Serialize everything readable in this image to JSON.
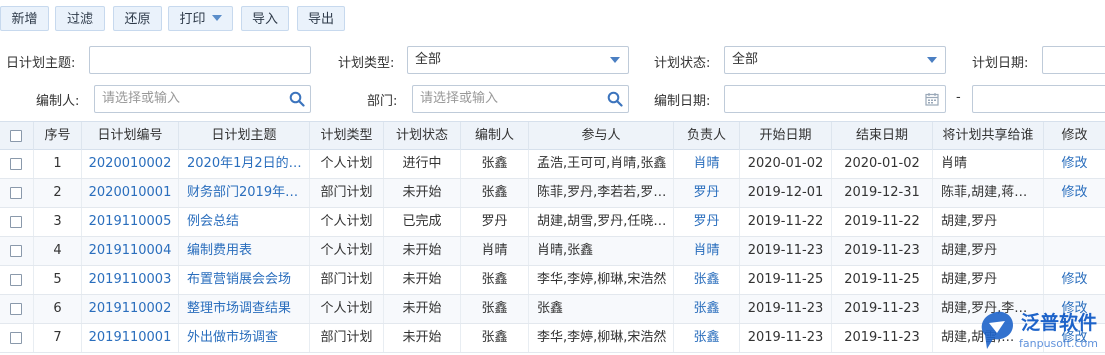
{
  "toolbar": {
    "new": "新增",
    "filter": "过滤",
    "reset": "还原",
    "print": "打印",
    "import": "导入",
    "export": "导出"
  },
  "filters": {
    "topic_label": "日计划主题:",
    "topic_value": "",
    "type_label": "计划类型:",
    "type_value": "全部",
    "status_label": "计划状态:",
    "status_value": "全部",
    "date_label": "计划日期:",
    "editor_label": "编制人:",
    "editor_placeholder": "请选择或输入",
    "dept_label": "部门:",
    "dept_placeholder": "请选择或输入",
    "edit_date_label": "编制日期:",
    "range_separator": "-"
  },
  "table": {
    "columns": [
      "序号",
      "日计划编号",
      "日计划主题",
      "计划类型",
      "计划状态",
      "编制人",
      "参与人",
      "负责人",
      "开始日期",
      "结束日期",
      "将计划共享给谁",
      "修改"
    ],
    "rows": [
      {
        "no": "1",
        "code": "2020010002",
        "topic": "2020年1月2日的…",
        "type": "个人计划",
        "status": "进行中",
        "editor": "张鑫",
        "participants": "孟浩,王可可,肖晴,张鑫",
        "owner": "肖晴",
        "start": "2020-01-02",
        "end": "2020-01-02",
        "share": "肖晴",
        "edit": "修改"
      },
      {
        "no": "2",
        "code": "2020010001",
        "topic": "财务部门2019年…",
        "type": "部门计划",
        "status": "未开始",
        "editor": "张鑫",
        "participants": "陈菲,罗丹,李若若,罗…",
        "owner": "罗丹",
        "start": "2019-12-01",
        "end": "2019-12-31",
        "share": "陈菲,胡建,蒋…",
        "edit": "修改"
      },
      {
        "no": "3",
        "code": "2019110005",
        "topic": "例会总结",
        "type": "个人计划",
        "status": "已完成",
        "editor": "罗丹",
        "participants": "胡建,胡雪,罗丹,任晓…",
        "owner": "罗丹",
        "start": "2019-11-22",
        "end": "2019-11-22",
        "share": "胡建,罗丹",
        "edit": ""
      },
      {
        "no": "4",
        "code": "2019110004",
        "topic": "编制费用表",
        "type": "个人计划",
        "status": "未开始",
        "editor": "肖晴",
        "participants": "肖晴,张鑫",
        "owner": "肖晴",
        "start": "2019-11-23",
        "end": "2019-11-23",
        "share": "胡建,罗丹",
        "edit": ""
      },
      {
        "no": "5",
        "code": "2019110003",
        "topic": "布置营销展会会场",
        "type": "部门计划",
        "status": "未开始",
        "editor": "张鑫",
        "participants": "李华,李婷,柳琳,宋浩然",
        "owner": "张鑫",
        "start": "2019-11-25",
        "end": "2019-11-25",
        "share": "胡建,罗丹",
        "edit": "修改"
      },
      {
        "no": "6",
        "code": "2019110002",
        "topic": "整理市场调查结果",
        "type": "个人计划",
        "status": "未开始",
        "editor": "张鑫",
        "participants": "张鑫",
        "owner": "张鑫",
        "start": "2019-11-23",
        "end": "2019-11-23",
        "share": "胡建,罗丹,李…",
        "edit": "修改"
      },
      {
        "no": "7",
        "code": "2019110001",
        "topic": "外出做市场调查",
        "type": "部门计划",
        "status": "未开始",
        "editor": "张鑫",
        "participants": "李华,李婷,柳琳,宋浩然",
        "owner": "张鑫",
        "start": "2019-11-23",
        "end": "2019-11-23",
        "share": "胡建,胡雪,…",
        "edit": "修改"
      }
    ]
  },
  "watermark": {
    "text": "泛普软件",
    "sub": "fanpusoft.com"
  },
  "colors": {
    "link": "#2a6ebd",
    "header_bg": "#eef3f9",
    "button_bg": "#eaf2fb",
    "logo_blue": "#1d63c9"
  }
}
